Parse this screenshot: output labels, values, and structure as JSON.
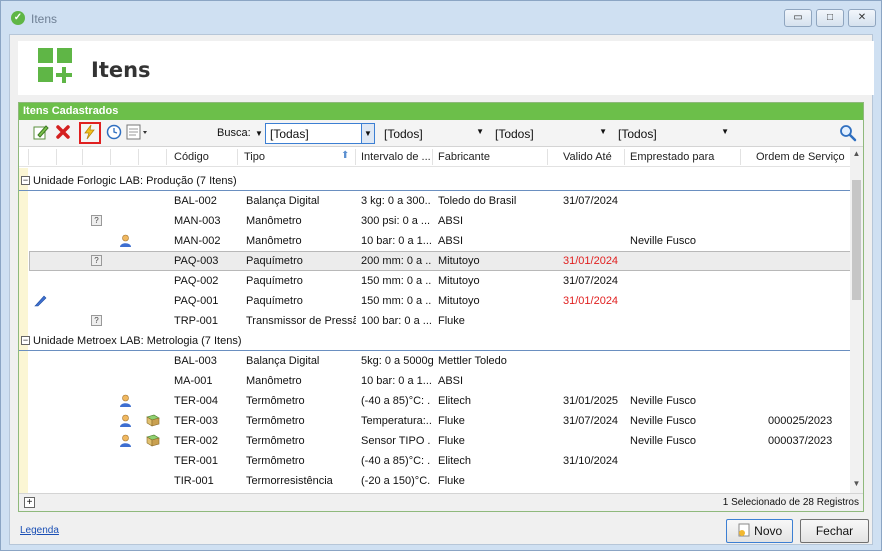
{
  "window": {
    "title": "Itens",
    "controls": [
      "▭",
      "□",
      "✕"
    ]
  },
  "header": {
    "title": "Itens"
  },
  "panel": {
    "title": "Itens Cadastrados"
  },
  "toolbar": {
    "busca_label": "Busca:",
    "filters": [
      "[Todas]",
      "[Todos]",
      "[Todos]",
      "[Todos]"
    ]
  },
  "columns": [
    "Código",
    "Tipo",
    "Intervalo de ...",
    "Fabricante",
    "Valido Até",
    "Emprestado para",
    "Ordem de Serviço"
  ],
  "groups": [
    {
      "label": "Unidade Forlogic LAB: Produção (7 Itens)",
      "rows": [
        {
          "codigo": "BAL-002",
          "tipo": "Balança Digital",
          "intervalo": "3 kg: 0 a 300...",
          "fabricante": "Toledo do Brasil",
          "valido": "31/07/2024",
          "emprestado": "",
          "os": ""
        },
        {
          "codigo": "MAN-003",
          "tipo": "Manômetro",
          "intervalo": "300 psi: 0 a ...",
          "fabricante": "ABSI",
          "valido": "",
          "emprestado": "",
          "os": ""
        },
        {
          "codigo": "MAN-002",
          "tipo": "Manômetro",
          "intervalo": "10 bar: 0 a 1...",
          "fabricante": "ABSI",
          "valido": "",
          "emprestado": "Neville Fusco",
          "os": ""
        },
        {
          "codigo": "PAQ-003",
          "tipo": "Paquímetro",
          "intervalo": "200 mm: 0 a ...",
          "fabricante": "Mitutoyo",
          "valido": "31/01/2024",
          "emprestado": "",
          "os": ""
        },
        {
          "codigo": "PAQ-002",
          "tipo": "Paquímetro",
          "intervalo": "150 mm: 0 a ...",
          "fabricante": "Mitutoyo",
          "valido": "31/07/2024",
          "emprestado": "",
          "os": ""
        },
        {
          "codigo": "PAQ-001",
          "tipo": "Paquímetro",
          "intervalo": "150 mm: 0 a ...",
          "fabricante": "Mitutoyo",
          "valido": "31/01/2024",
          "emprestado": "",
          "os": ""
        },
        {
          "codigo": "TRP-001",
          "tipo": "Transmissor de Pressão",
          "intervalo": "100 bar: 0 a ...",
          "fabricante": "Fluke",
          "valido": "",
          "emprestado": "",
          "os": ""
        }
      ]
    },
    {
      "label": "Unidade Metroex LAB: Metrologia (7 Itens)",
      "rows": [
        {
          "codigo": "BAL-003",
          "tipo": "Balança Digital",
          "intervalo": "5kg: 0 a 5000g",
          "fabricante": "Mettler Toledo",
          "valido": "",
          "emprestado": "",
          "os": ""
        },
        {
          "codigo": "MA-001",
          "tipo": "Manômetro",
          "intervalo": "10 bar: 0 a 1...",
          "fabricante": "ABSI",
          "valido": "",
          "emprestado": "",
          "os": ""
        },
        {
          "codigo": "TER-004",
          "tipo": "Termômetro",
          "intervalo": "(-40 a 85)°C: ...",
          "fabricante": "Elitech",
          "valido": "31/01/2025",
          "emprestado": "Neville Fusco",
          "os": ""
        },
        {
          "codigo": "TER-003",
          "tipo": "Termômetro",
          "intervalo": "Temperatura:...",
          "fabricante": "Fluke",
          "valido": "31/07/2024",
          "emprestado": "Neville Fusco",
          "os": "000025/2023"
        },
        {
          "codigo": "TER-002",
          "tipo": "Termômetro",
          "intervalo": "Sensor TIPO ...",
          "fabricante": "Fluke",
          "valido": "",
          "emprestado": "Neville Fusco",
          "os": "000037/2023"
        },
        {
          "codigo": "TER-001",
          "tipo": "Termômetro",
          "intervalo": "(-40 a 85)°C: ...",
          "fabricante": "Elitech",
          "valido": "31/10/2024",
          "emprestado": "",
          "os": ""
        },
        {
          "codigo": "TIR-001",
          "tipo": "Termorresistência",
          "intervalo": "(-20 a 150)°C...",
          "fabricante": "Fluke",
          "valido": "",
          "emprestado": "",
          "os": ""
        }
      ]
    }
  ],
  "status": {
    "text": "1 Selecionado de 28 Registros"
  },
  "footer": {
    "legend_link": "Legenda",
    "new_button": "Novo",
    "close_button": "Fechar"
  },
  "colors": {
    "accent_green": "#6cbf4a",
    "expired_red": "#e02020"
  }
}
